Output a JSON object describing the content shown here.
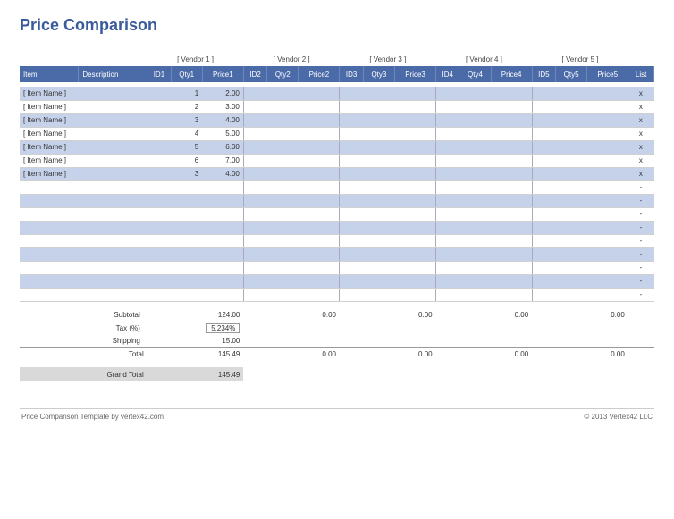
{
  "title": "Price Comparison",
  "vendors": [
    "[ Vendor 1 ]",
    "[ Vendor 2 ]",
    "[ Vendor 3 ]",
    "[ Vendor 4 ]",
    "[ Vendor 5 ]"
  ],
  "columns": {
    "item": "Item",
    "description": "Description",
    "id": [
      "ID1",
      "ID2",
      "ID3",
      "ID4",
      "ID5"
    ],
    "qty": [
      "Qty1",
      "Qty2",
      "Qty3",
      "Qty4",
      "Qty5"
    ],
    "price": [
      "Price1",
      "Price2",
      "Price3",
      "Price4",
      "Price5"
    ],
    "list": "List"
  },
  "rows": [
    {
      "item": "[ Item Name ]",
      "qty1": "1",
      "price1": "2.00",
      "list": "x"
    },
    {
      "item": "[ Item Name ]",
      "qty1": "2",
      "price1": "3.00",
      "list": "x"
    },
    {
      "item": "[ Item Name ]",
      "qty1": "3",
      "price1": "4.00",
      "list": "x"
    },
    {
      "item": "[ Item Name ]",
      "qty1": "4",
      "price1": "5.00",
      "list": "x"
    },
    {
      "item": "[ Item Name ]",
      "qty1": "5",
      "price1": "6.00",
      "list": "x"
    },
    {
      "item": "[ Item Name ]",
      "qty1": "6",
      "price1": "7.00",
      "list": "x"
    },
    {
      "item": "[ Item Name ]",
      "qty1": "3",
      "price1": "4.00",
      "list": "x"
    },
    {
      "list": "-"
    },
    {
      "list": "-"
    },
    {
      "list": "-"
    },
    {
      "list": "-"
    },
    {
      "list": "-"
    },
    {
      "list": "-"
    },
    {
      "list": "-"
    },
    {
      "list": "-"
    },
    {
      "list": "-"
    }
  ],
  "summary": {
    "subtotal_label": "Subtotal",
    "tax_label": "Tax (%)",
    "shipping_label": "Shipping",
    "total_label": "Total",
    "grand_label": "Grand Total",
    "subtotal": [
      "124.00",
      "0.00",
      "0.00",
      "0.00",
      "0.00"
    ],
    "tax_pct": "5.234%",
    "shipping": [
      "15.00",
      "",
      "",
      "",
      ""
    ],
    "total": [
      "145.49",
      "0.00",
      "0.00",
      "0.00",
      "0.00"
    ],
    "grand": "145.49"
  },
  "footer": {
    "left": "Price Comparison Template by vertex42.com",
    "right": "© 2013 Vertex42 LLC"
  }
}
